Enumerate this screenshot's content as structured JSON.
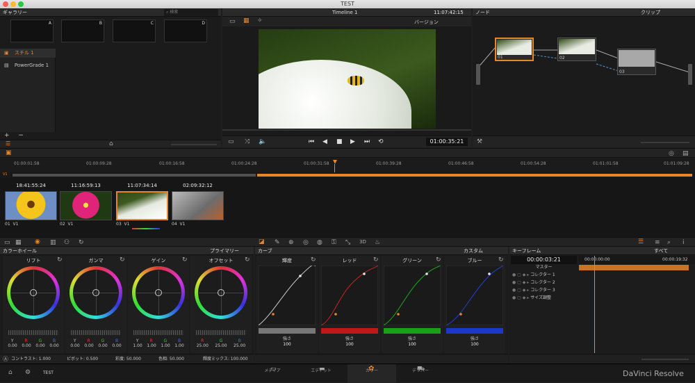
{
  "window": {
    "title": "TEST"
  },
  "gallery": {
    "title": "ギャラリー",
    "search_placeholder": "検索",
    "slots": [
      "A",
      "B",
      "C",
      "D"
    ],
    "albums": [
      {
        "label": "スチル 1",
        "active": true
      },
      {
        "label": "PowerGrade 1",
        "active": false
      }
    ],
    "add": "+",
    "remove": "−"
  },
  "viewer": {
    "timeline_name": "Timeline 1",
    "timecode_top": "11:07:42:15",
    "version_label": "バージョン",
    "timecode_bottom": "01:00:35:21"
  },
  "nodes": {
    "title": "ノード",
    "mode": "クリップ",
    "items": [
      {
        "label": "01"
      },
      {
        "label": "02"
      },
      {
        "label": "03"
      }
    ]
  },
  "timeline": {
    "ruler": [
      "01:00:01:58",
      "01:00:09:28",
      "01:00:16:58",
      "01:00:24:28",
      "01:00:31:58",
      "01:00:39:28",
      "01:00:46:58",
      "01:00:54:28",
      "01:01:01:58",
      "01:01:09:28"
    ],
    "track_label": "V1",
    "clips": [
      {
        "timecode": "18:41:55:24",
        "label": "01",
        "track": "V1"
      },
      {
        "timecode": "11:16:59:13",
        "label": "02",
        "track": "V1"
      },
      {
        "timecode": "11:07:34:14",
        "label": "03",
        "track": "V1",
        "active": true
      },
      {
        "timecode": "02:09:32:12",
        "label": "04",
        "track": "V1"
      }
    ]
  },
  "color_wheels": {
    "title": "カラーホイール",
    "mode": "プライマリー",
    "wheels": [
      {
        "label": "リフト",
        "keys": [
          "Y",
          "R",
          "G",
          "B"
        ],
        "values": [
          "0.00",
          "0.00",
          "0.00",
          "0.00"
        ]
      },
      {
        "label": "ガンマ",
        "keys": [
          "Y",
          "R",
          "G",
          "B"
        ],
        "values": [
          "0.00",
          "0.00",
          "0.00",
          "0.00"
        ]
      },
      {
        "label": "ゲイン",
        "keys": [
          "Y",
          "R",
          "G",
          "B"
        ],
        "values": [
          "1.00",
          "1.00",
          "1.00",
          "1.00"
        ]
      },
      {
        "label": "オフセット",
        "keys": [
          "R",
          "G",
          "B"
        ],
        "values": [
          "25.00",
          "25.00",
          "25.00"
        ]
      }
    ],
    "footer": {
      "contrast": "コントラスト: 1.000",
      "pivot": "ピボット: 0.500",
      "saturation": "彩度: 50.000",
      "hue": "色相: 50.000",
      "lum_mix": "輝度ミックス: 100.000"
    }
  },
  "curves": {
    "title": "カーブ",
    "mode": "カスタム",
    "channels": [
      {
        "label": "輝度",
        "strength_label": "強さ",
        "strength": "100",
        "color": "#cccccc"
      },
      {
        "label": "レッド",
        "strength_label": "強さ",
        "strength": "100",
        "color": "#d02020"
      },
      {
        "label": "グリーン",
        "strength_label": "強さ",
        "strength": "100",
        "color": "#20a020"
      },
      {
        "label": "ブルー",
        "strength_label": "強さ",
        "strength": "100",
        "color": "#2040d0"
      }
    ]
  },
  "keyframes": {
    "title": "キーフレーム",
    "filter": "すべて",
    "timecode": "00:00:03:21",
    "ruler_start": "00:00:00:00",
    "ruler_end": "00:00:19:32",
    "rows": [
      "マスター",
      "コレクター 1",
      "コレクター 2",
      "コレクター 3",
      "サイズ調整"
    ]
  },
  "pages": {
    "project": "TEST",
    "tabs": [
      {
        "label": "メディア",
        "active": false
      },
      {
        "label": "エディット",
        "active": false
      },
      {
        "label": "カラー",
        "active": true
      },
      {
        "label": "デリバー",
        "active": false
      }
    ],
    "brand": "DaVinci Resolve"
  },
  "colors": {
    "accent": "#e8862b",
    "background": "#1e1e1e"
  }
}
